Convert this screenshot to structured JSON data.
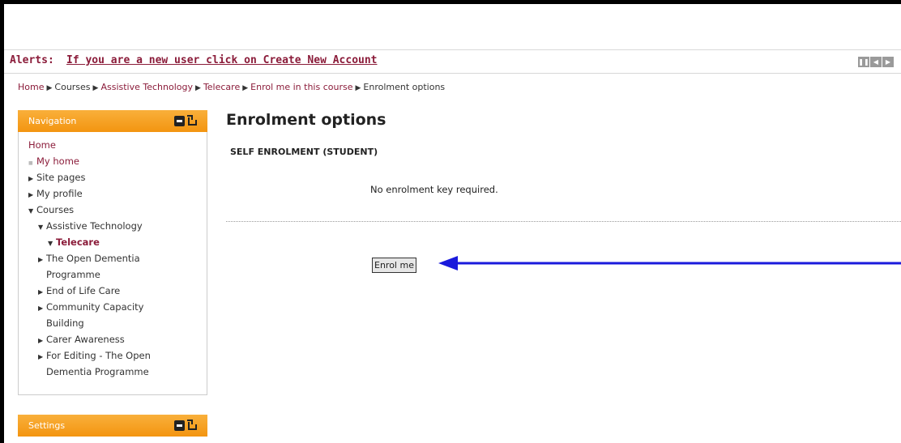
{
  "alerts": {
    "label": "Alerts:",
    "link_text": "If you are a new user click on Create New Account"
  },
  "breadcrumb": [
    {
      "label": "Home",
      "link": true
    },
    {
      "label": "Courses",
      "link": false
    },
    {
      "label": "Assistive Technology",
      "link": true
    },
    {
      "label": "Telecare",
      "link": true
    },
    {
      "label": "Enrol me in this course",
      "link": true
    },
    {
      "label": "Enrolment options",
      "link": false
    }
  ],
  "navigation": {
    "title": "Navigation",
    "items": [
      {
        "label": "Home",
        "indent": 0,
        "marker": "none",
        "style": "link"
      },
      {
        "label": "My home",
        "indent": 1,
        "marker": "square",
        "style": "link"
      },
      {
        "label": "Site pages",
        "indent": 1,
        "marker": "right",
        "style": "normal"
      },
      {
        "label": "My profile",
        "indent": 1,
        "marker": "right",
        "style": "normal"
      },
      {
        "label": "Courses",
        "indent": 1,
        "marker": "down",
        "style": "normal"
      },
      {
        "label": "Assistive Technology",
        "indent": 2,
        "marker": "down",
        "style": "normal"
      },
      {
        "label": "Telecare",
        "indent": 3,
        "marker": "down",
        "style": "active"
      },
      {
        "label": "The Open Dementia Programme",
        "indent": 2,
        "marker": "right",
        "style": "normal",
        "wrap": [
          "The Open Dementia",
          "Programme"
        ]
      },
      {
        "label": "End of Life Care",
        "indent": 2,
        "marker": "right",
        "style": "normal"
      },
      {
        "label": "Community Capacity Building",
        "indent": 2,
        "marker": "right",
        "style": "normal",
        "wrap": [
          "Community Capacity",
          "Building"
        ]
      },
      {
        "label": "Carer Awareness",
        "indent": 2,
        "marker": "right",
        "style": "normal"
      },
      {
        "label": "For Editing - The Open Dementia Programme",
        "indent": 2,
        "marker": "right",
        "style": "normal",
        "wrap": [
          "For Editing - The Open",
          "Dementia Programme"
        ]
      }
    ]
  },
  "settings": {
    "title": "Settings"
  },
  "main": {
    "title": "Enrolment options",
    "section_title": "SELF ENROLMENT (STUDENT)",
    "info": "No enrolment key required.",
    "button_label": "Enrol me"
  },
  "colors": {
    "link": "#8b1c3a",
    "block_header": "#f39510",
    "annotation_arrow": "#1a1adc"
  },
  "icons": [
    "hide-block-icon",
    "dock-block-icon",
    "ticker-pause-icon",
    "ticker-prev-icon",
    "ticker-next-icon",
    "annotation-arrow-icon"
  ]
}
